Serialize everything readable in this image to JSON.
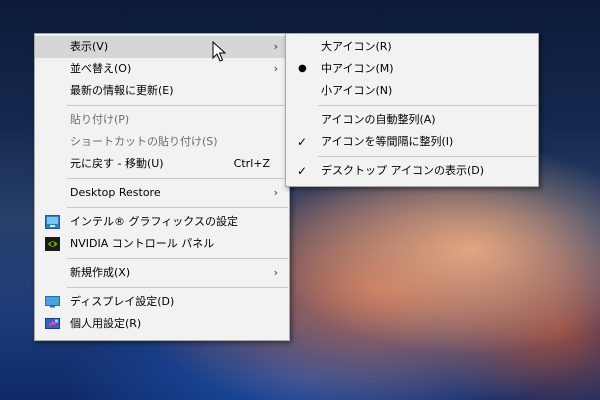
{
  "context_menu": {
    "items": [
      {
        "label": "表示(V)",
        "has_submenu": true,
        "highlighted": true
      },
      {
        "label": "並べ替え(O)",
        "has_submenu": true
      },
      {
        "label": "最新の情報に更新(E)"
      },
      {
        "label": "貼り付け(P)",
        "disabled": true
      },
      {
        "label": "ショートカットの貼り付け(S)",
        "disabled": true
      },
      {
        "label": "元に戻す - 移動(U)",
        "shortcut": "Ctrl+Z"
      },
      {
        "label": "Desktop Restore",
        "has_submenu": true
      },
      {
        "label": "インテル® グラフィックスの設定",
        "icon": "intel-graphics-icon"
      },
      {
        "label": "NVIDIA コントロール パネル",
        "icon": "nvidia-icon"
      },
      {
        "label": "新規作成(X)",
        "has_submenu": true
      },
      {
        "label": "ディスプレイ設定(D)",
        "icon": "display-icon"
      },
      {
        "label": "個人用設定(R)",
        "icon": "personalize-icon"
      }
    ]
  },
  "view_submenu": {
    "items": [
      {
        "label": "大アイコン(R)"
      },
      {
        "label": "中アイコン(M)",
        "marker": "bullet",
        "marker_glyph": "●"
      },
      {
        "label": "小アイコン(N)"
      },
      {
        "label": "アイコンの自動整列(A)"
      },
      {
        "label": "アイコンを等間隔に整列(I)",
        "marker": "check",
        "marker_glyph": "✓"
      },
      {
        "label": "デスクトップ アイコンの表示(D)",
        "marker": "check",
        "marker_glyph": "✓"
      }
    ]
  },
  "glyphs": {
    "submenu_arrow": "›"
  },
  "colors": {
    "menu_bg": "#f2f2f2",
    "highlight": "#d6d6d6",
    "disabled_text": "#6d6d6d"
  }
}
